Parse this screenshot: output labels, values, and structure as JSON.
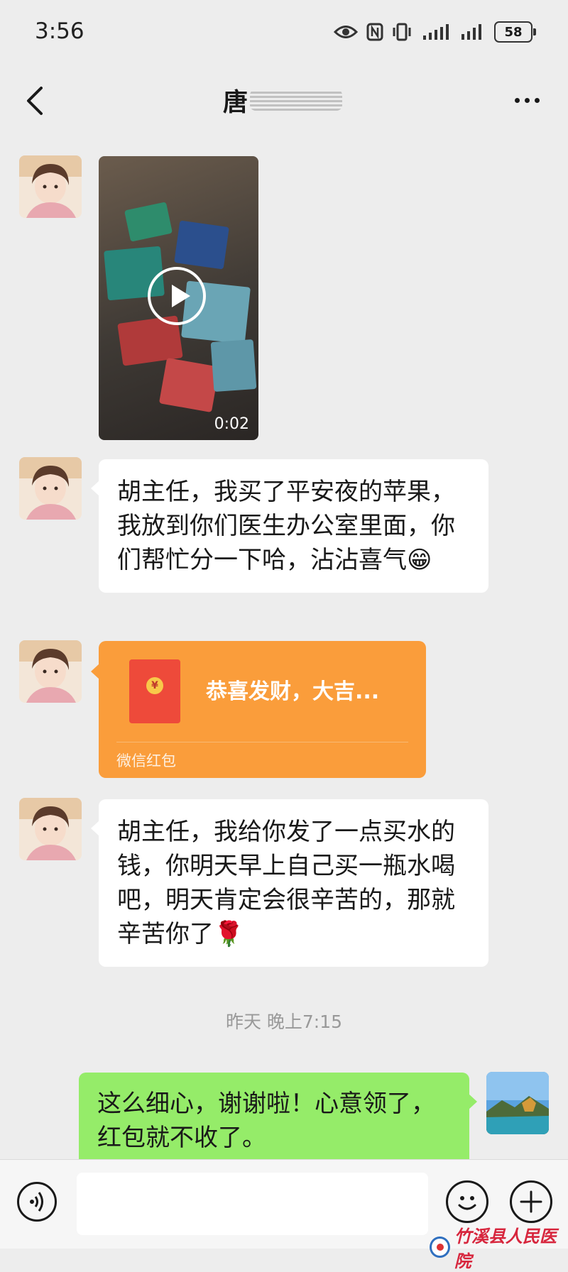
{
  "status_bar": {
    "time": "3:56",
    "battery": "58",
    "icons": [
      "eye-icon",
      "nfc-icon",
      "vibrate-icon",
      "signal-icon",
      "signal-icon",
      "battery-icon"
    ]
  },
  "header": {
    "title": "唐",
    "back_icon": "chevron-left-icon",
    "more_icon": "ellipsis-icon"
  },
  "messages": [
    {
      "type": "video",
      "sender": "other",
      "duration": "0:02"
    },
    {
      "type": "text",
      "sender": "other",
      "text": "胡主任，我买了平安夜的苹果，我放到你们医生办公室里面，你们帮忙分一下哈，沾沾喜气😁"
    },
    {
      "type": "red_packet",
      "sender": "other",
      "title": "恭喜发财，大吉...",
      "label": "微信红包",
      "coin": "¥"
    },
    {
      "type": "text",
      "sender": "other",
      "text": "胡主任，我给你发了一点买水的钱，你明天早上自己买一瓶水喝吧，明天肯定会很辛苦的，那就辛苦你了🌹"
    },
    {
      "type": "timestamp",
      "text": "昨天 晚上7:15"
    },
    {
      "type": "text",
      "sender": "self",
      "text": "这么细心，谢谢啦！心意领了，红包就不收了。"
    }
  ],
  "input_bar": {
    "value": "",
    "voice_icon": "voice-icon",
    "emoji_icon": "emoji-icon",
    "plus_icon": "plus-icon"
  },
  "watermark": {
    "text": "竹溪县人民医院"
  },
  "colors": {
    "background": "#ededed",
    "self_bubble": "#95ec69",
    "red_packet": "#fa9d3b",
    "envelope": "#ee4a3a"
  }
}
